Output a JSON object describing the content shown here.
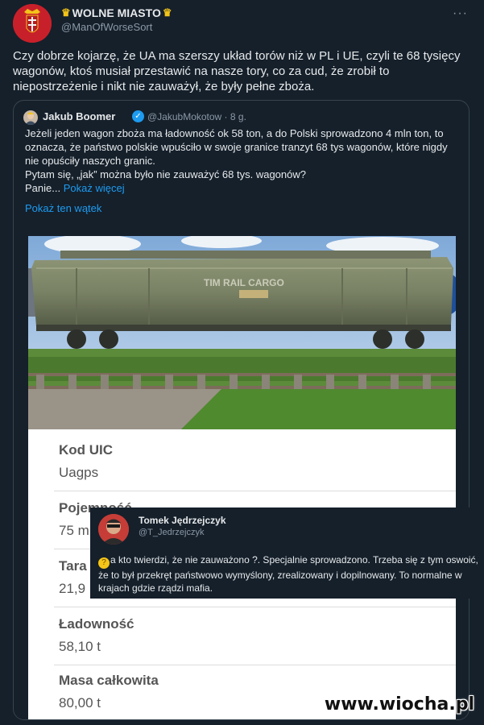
{
  "tweet": {
    "author": "WOLNE MIASTO",
    "handle": "@ManOfWorseSort",
    "more": "···",
    "text": "Czy dobrze kojarzę, że UA ma szerszy układ torów niż w PL i UE, czyli te 68 tysięcy wagonów, ktoś musiał przestawić na nasze tory, co za cud, że zrobił to niepostrzeżenie i nikt nie zauważył, że były pełne zboża."
  },
  "quote": {
    "author": "Jakub Boomer",
    "handle": "@JakubMokotow · 8 g.",
    "text": "Jeżeli jeden wagon zboża ma ładowność ok 58 ton, a do Polski sprowadzono 4 mln ton, to oznacza, że państwo polskie wpuściło w swoje granice tranzyt 68 tys wagonów, które nigdy nie opuściły naszych granic.\nPytam się, „jak” można było nie zauważyć 68 tys. wagonów?\nPanie...",
    "show_more": "Pokaż więcej",
    "thread_link": "Pokaż ten wątek"
  },
  "photo": {
    "wagon_lettering": "TIM RAIL CARGO"
  },
  "info_card": {
    "rows": [
      {
        "label": "Kod UIC",
        "value": "Uagps"
      },
      {
        "label": "Pojemność",
        "value": "75 m"
      },
      {
        "label": "Tara",
        "value": "21,9"
      },
      {
        "label": "Ładowność",
        "value": "58,10 t"
      },
      {
        "label": "Masa całkowita",
        "value": "80,00 t"
      }
    ]
  },
  "reply": {
    "author": "Tomek Jędrzejczyk",
    "handle": "@T_Jedrzejczyk",
    "emoji": "thinking-face",
    "text": "a kto twierdzi, że nie zauważono ?. Specjalnie sprowadzono. Trzeba się z tym oswoić, że to był przekręt państwowo wymyślony, zrealizowany i dopilnowany. To normalne w krajach gdzie rządzi mafia."
  },
  "watermark": "www.wiocha.pl",
  "colors": {
    "background": "#15202b",
    "link": "#1d9bf0",
    "muted": "#8b98a5",
    "border": "#38444d"
  }
}
